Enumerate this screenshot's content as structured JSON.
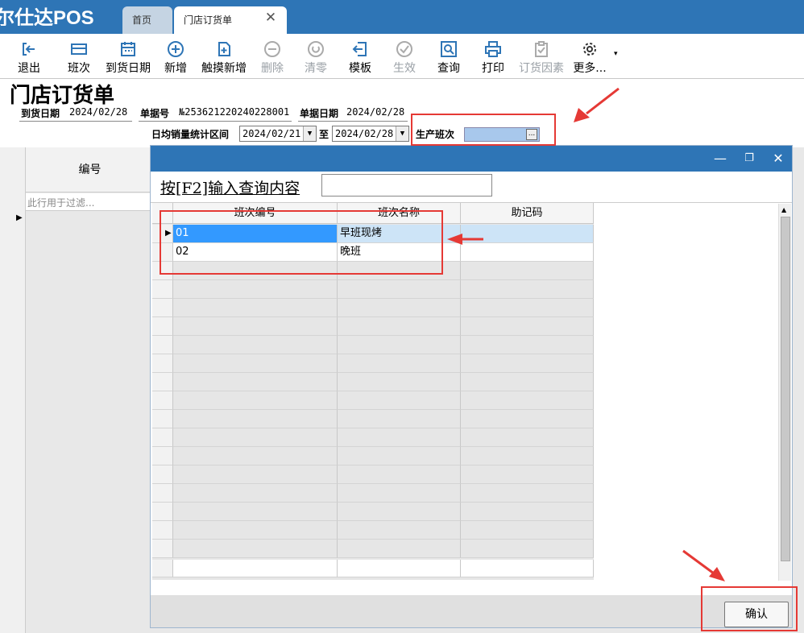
{
  "app": {
    "brand": "尔仕达POS"
  },
  "tabs": [
    {
      "label": "首页"
    },
    {
      "label": "门店订货单"
    }
  ],
  "toolbar": {
    "buttons": [
      {
        "label": "退出"
      },
      {
        "label": "班次"
      },
      {
        "label": "到货日期"
      },
      {
        "label": "新增"
      },
      {
        "label": "触摸新增"
      },
      {
        "label": "删除"
      },
      {
        "label": "清零"
      },
      {
        "label": "模板"
      },
      {
        "label": "生效"
      },
      {
        "label": "查询"
      },
      {
        "label": "打印"
      },
      {
        "label": "订货因素"
      },
      {
        "label": "更多..."
      }
    ],
    "more_arrow": "▾"
  },
  "page": {
    "title": "门店订货单"
  },
  "form": {
    "arrival_date_label": "到货日期",
    "arrival_date": "2024/02/28",
    "doc_no_label": "单据号",
    "doc_no": "№253621220240228001",
    "doc_date_label": "单据日期",
    "doc_date": "2024/02/28",
    "range_label": "日均销量统计区间",
    "range_from": "2024/02/21",
    "range_to_label": "至",
    "range_to": "2024/02/28",
    "shift_label": "生产班次",
    "shift_value": "",
    "shift_btn": "..."
  },
  "bg_grid": {
    "column_header": "编号",
    "filter_placeholder": "此行用于过滤..."
  },
  "dialog": {
    "search_label": "按[F2]输入查询内容",
    "search_value": "",
    "columns": [
      "班次编号",
      "班次名称",
      "助记码"
    ],
    "rows": [
      {
        "code": "01",
        "name": "早班现烤",
        "mnemonic": ""
      },
      {
        "code": "02",
        "name": "晚班",
        "mnemonic": ""
      }
    ],
    "confirm_label": "确认"
  },
  "colors": {
    "brand_blue": "#2e75b6",
    "highlight": "#b8d9f5",
    "annotation_red": "#e53935"
  }
}
